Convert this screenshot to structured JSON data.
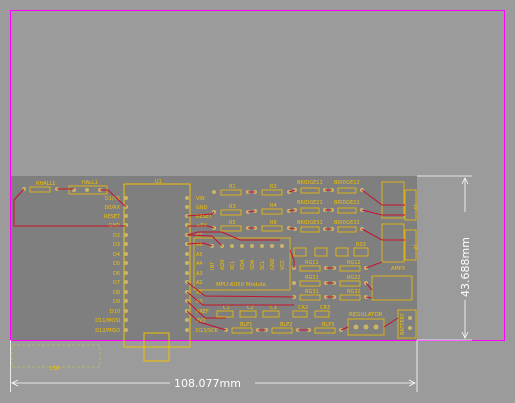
{
  "board": {
    "background": "#9b9b9b",
    "pcb_color": "#7f7f7f",
    "outline_color": "#ff00ff",
    "silk_color": "#f2c000",
    "trace_color": "#c8102e",
    "pad_color": "#c9b56a",
    "dimension_color": "#ffffff"
  },
  "dimensions": {
    "width": "108.077mm",
    "height": "43.688mm"
  },
  "components": {
    "rhall": "RHALL1",
    "hall": "HALL1",
    "u1": "U1",
    "module": "MPU-6050 Module",
    "r1": "R1",
    "r2": "R2",
    "r3": "R3",
    "r4": "R4",
    "r5": "R5",
    "r6": "R6",
    "bridge11": "BRIDGE11",
    "bridge12": "BRIDGE12",
    "bridge21": "BRIDGE21",
    "bridge22": "BRIDGE22",
    "bridge31": "BRIDGE31",
    "bridge32": "BRIDGE32",
    "rg11": "RG11",
    "rg12": "RG12",
    "rg21": "RG21",
    "rg22": "RG22",
    "rg31": "RG31",
    "rg32": "RG32",
    "rs3": "RS3",
    "amp3": "AMP3",
    "c1": "C1",
    "c2": "C2",
    "c3": "C3",
    "blp1": "BLP1",
    "blp2": "BLP2",
    "blp3": "BLP3",
    "cr2": "CR2",
    "cr3": "CR3",
    "regulator": "REGULATOR",
    "battery": "BATTERY",
    "j1": "J1",
    "j2": "J2",
    "j3": "J3"
  },
  "u1_pins_left": [
    "D1/TX",
    "D0/RX",
    "RESET",
    "GND",
    "D2",
    "D3",
    "D4",
    "D5",
    "D6",
    "D7",
    "D8",
    "D9",
    "D10",
    "D11/MOSI",
    "D12/MISO"
  ],
  "u1_pins_right": [
    "VIN",
    "GND",
    "RESET",
    "+5V",
    "A7",
    "A6",
    "A5",
    "A4",
    "A3",
    "A2",
    "A1",
    "A0",
    "AREF",
    "3V3",
    "D13/SCK"
  ],
  "mpu_pins": [
    "VCC",
    "GND",
    "SCL",
    "SDA",
    "XDA",
    "XCL",
    "AD0",
    "INT"
  ]
}
